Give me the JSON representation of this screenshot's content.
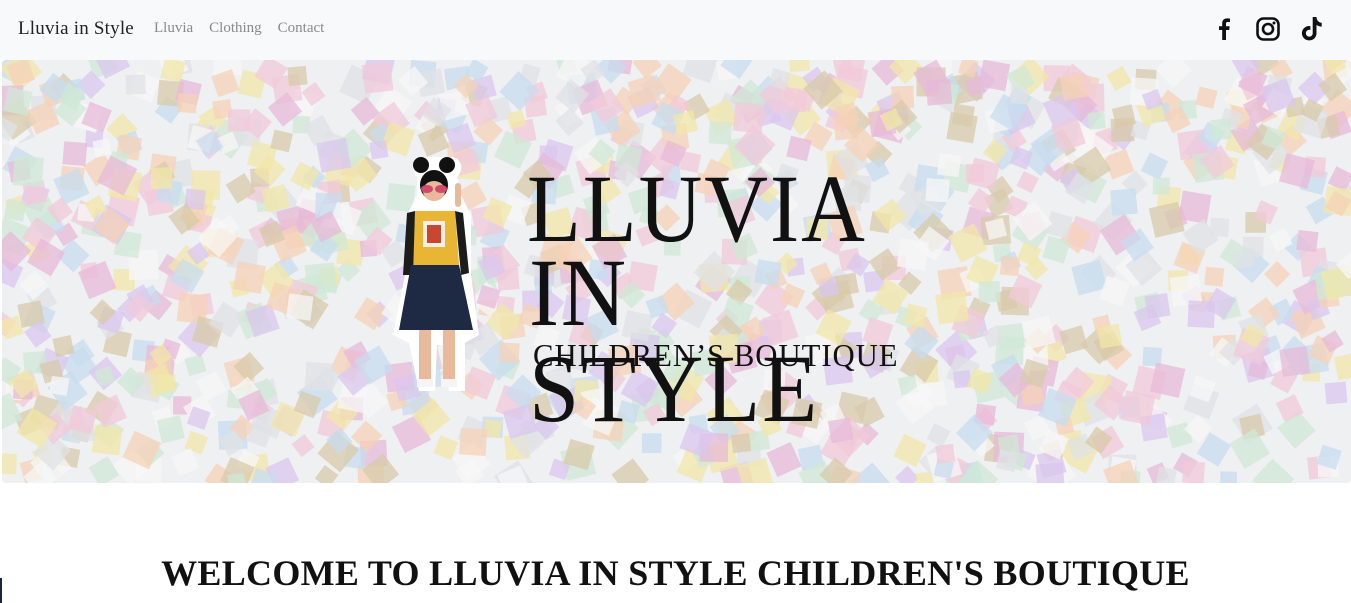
{
  "navbar": {
    "brand": "Lluvia in Style",
    "links": [
      "Lluvia",
      "Clothing",
      "Contact"
    ],
    "social": [
      "facebook-icon",
      "instagram-icon",
      "tiktok-icon"
    ]
  },
  "hero": {
    "logo_line1": "LLUVIA",
    "logo_line2": "IN STYLE",
    "logo_sub": "CHILDREN’S BOUTIQUE"
  },
  "main": {
    "heading": "WELCOME TO LLUVIA IN STYLE CHILDREN'S BOUTIQUE"
  },
  "colors": {
    "navbar_bg": "#f8f9fa",
    "nav_link": "#8a8a8a",
    "text": "#111111"
  }
}
